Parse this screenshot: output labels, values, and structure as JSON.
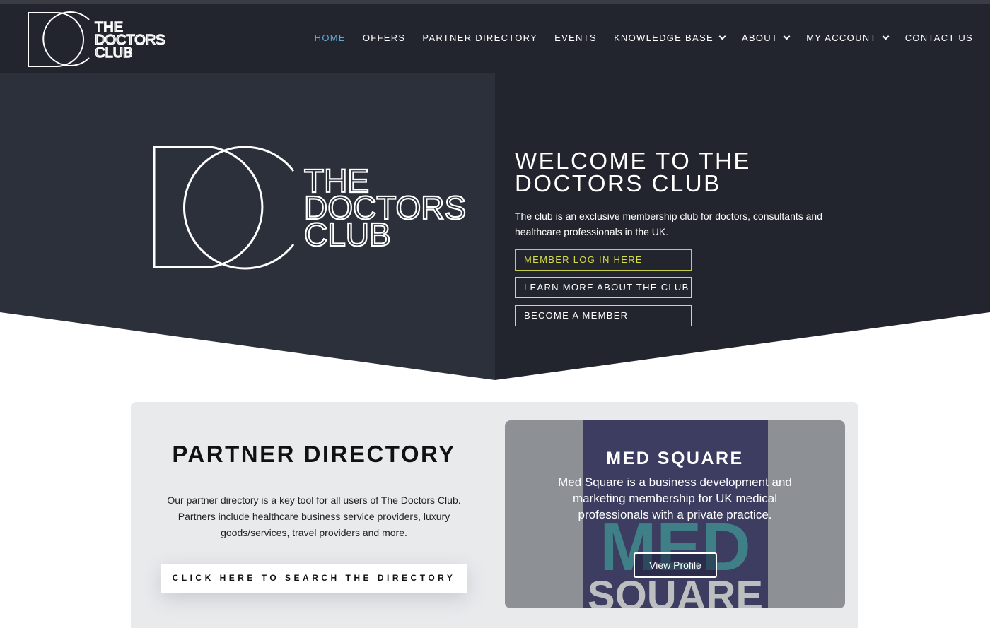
{
  "colors": {
    "header_bg": "#22252d",
    "hero_left_bg": "#2c303a",
    "hero_right_bg": "#22252d",
    "nav_active": "#5aa7d8",
    "primary_button": "#d4dc4a",
    "card_bg": "#e9eaec",
    "feature_bg": "#8e9297"
  },
  "logo": {
    "monogram": "DC",
    "line1": "THE",
    "line2": "DOCTORS",
    "line3": "CLUB"
  },
  "nav": {
    "items": [
      {
        "label": "HOME",
        "active": true,
        "dropdown": false
      },
      {
        "label": "OFFERS",
        "active": false,
        "dropdown": false
      },
      {
        "label": "PARTNER DIRECTORY",
        "active": false,
        "dropdown": false
      },
      {
        "label": "EVENTS",
        "active": false,
        "dropdown": false
      },
      {
        "label": "KNOWLEDGE BASE",
        "active": false,
        "dropdown": true
      },
      {
        "label": "ABOUT",
        "active": false,
        "dropdown": true
      },
      {
        "label": "MY ACCOUNT",
        "active": false,
        "dropdown": true
      },
      {
        "label": "CONTACT US",
        "active": false,
        "dropdown": false
      }
    ]
  },
  "hero": {
    "title_line1": "WELCOME TO THE",
    "title_line2": "DOCTORS CLUB",
    "description": "The club is an exclusive membership club for doctors, consultants and healthcare professionals in the UK.",
    "buttons": {
      "login": "MEMBER LOG IN HERE",
      "learn": "LEARN MORE ABOUT THE CLUB",
      "join": "BECOME A MEMBER"
    }
  },
  "partner": {
    "title": "PARTNER DIRECTORY",
    "text": "Our partner directory is a key tool for all users of The Doctors Club. Partners include healthcare business service providers, luxury goods/services, travel providers and more.",
    "button": "CLICK HERE TO SEARCH THE DIRECTORY",
    "feature": {
      "title": "MED SQUARE",
      "text": "Med Square is a business development and marketing membership for UK medical professionals with a private practice.",
      "button": "View Profile",
      "image_word1": "MED",
      "image_word2": "SQUARE"
    }
  }
}
